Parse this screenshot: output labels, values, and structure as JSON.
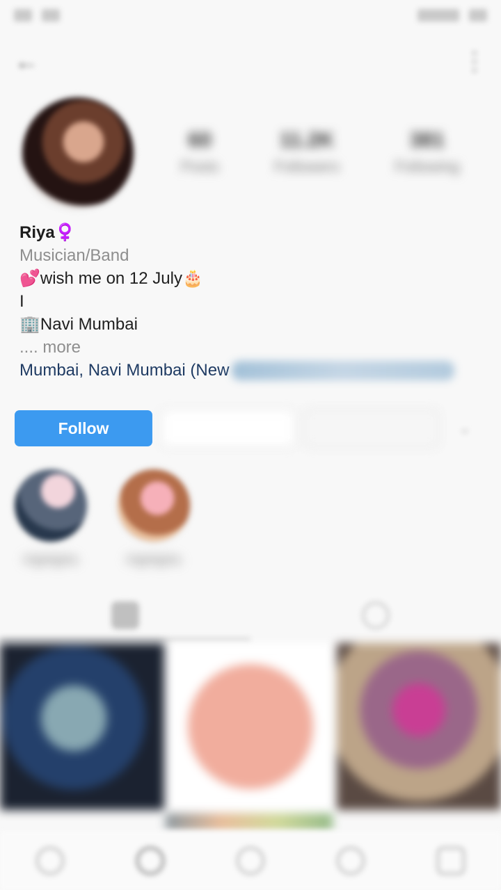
{
  "profile": {
    "name": "Riya♀️",
    "category": "Musician/Band",
    "bio_lines": [
      "💕wish me on 12 July🎂",
      "I",
      "🏢Navi Mumbai"
    ],
    "more_text": ".... more",
    "location_visible": "Mumbai, Navi Mumbai (New"
  },
  "actions": {
    "follow_label": "Follow"
  },
  "icons": {
    "back": "back-arrow-icon",
    "menu": "more-menu-icon",
    "grid": "grid-icon",
    "tagged": "tagged-icon",
    "home": "home-icon",
    "search": "search-icon",
    "add": "add-post-icon",
    "activity": "heart-icon",
    "profile": "profile-icon"
  },
  "colors": {
    "follow": "#3c9af0",
    "location": "#1f3b63"
  }
}
